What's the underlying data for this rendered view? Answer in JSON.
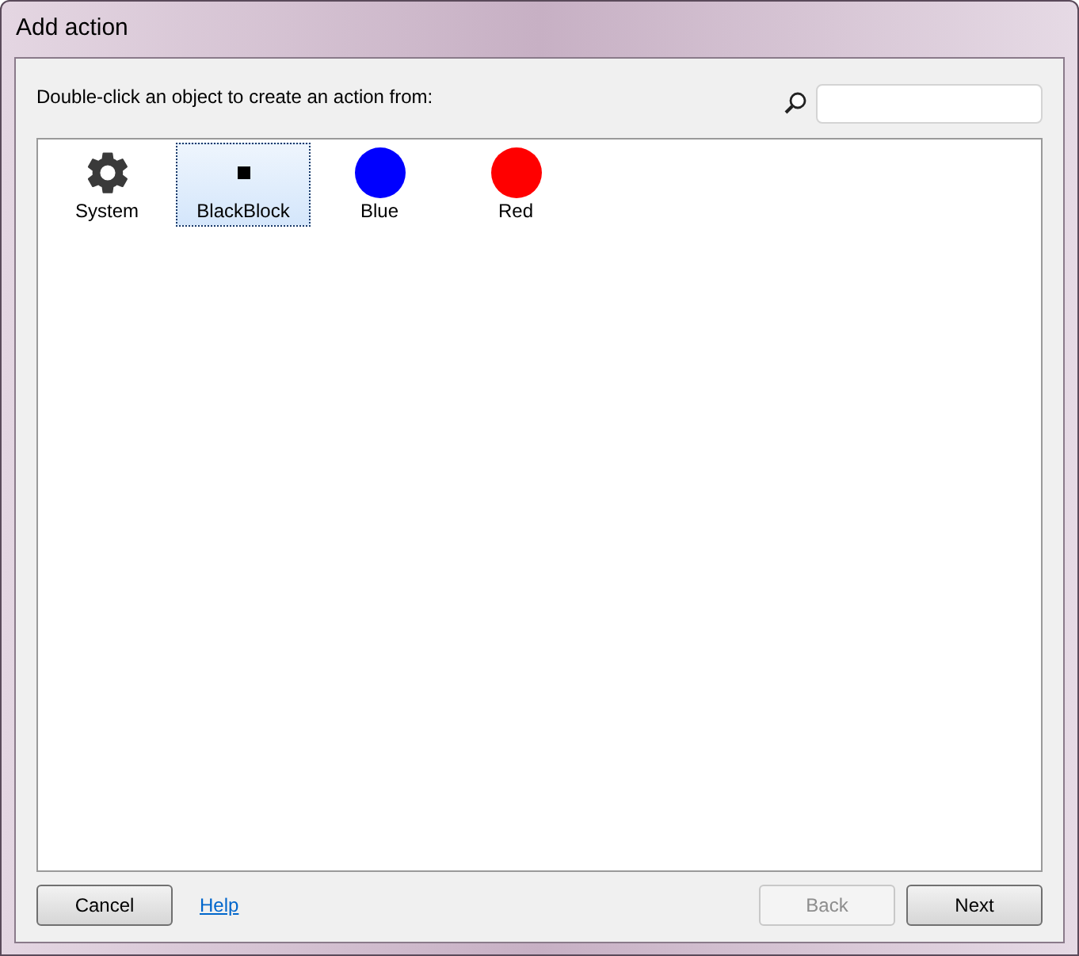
{
  "window": {
    "title": "Add action"
  },
  "instruction": "Double-click an object to create an action from:",
  "objects": [
    {
      "label": "System",
      "kind": "gear",
      "selected": false
    },
    {
      "label": "BlackBlock",
      "kind": "square",
      "selected": true
    },
    {
      "label": "Blue",
      "kind": "circle",
      "color": "#0000ff",
      "selected": false
    },
    {
      "label": "Red",
      "kind": "circle",
      "color": "#ff0000",
      "selected": false
    }
  ],
  "buttons": [
    {
      "label": "Cancel",
      "kind": "button",
      "disabled": false
    },
    {
      "label": "Help",
      "kind": "link",
      "disabled": false
    },
    {
      "label": "Back",
      "kind": "button",
      "disabled": true
    },
    {
      "label": "Next",
      "kind": "button",
      "disabled": false
    }
  ]
}
